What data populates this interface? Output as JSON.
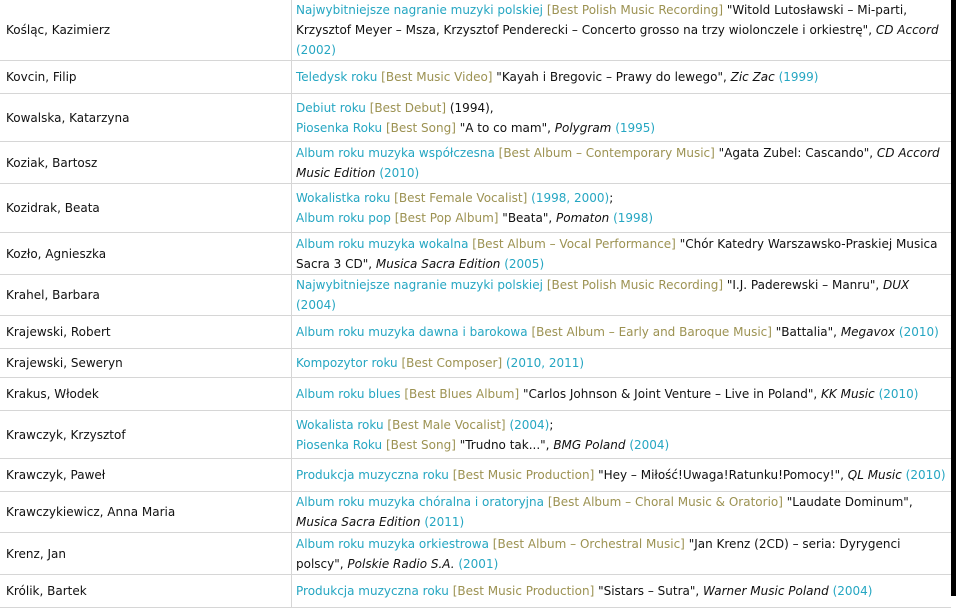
{
  "rows": [
    {
      "name": "Kośląc, Kazimierz",
      "h": 57,
      "lines": [
        [
          {
            "t": "pl",
            "v": "Najwybitniejsze nagranie muzyki polskiej"
          },
          {
            "t": "sp",
            "v": " "
          },
          {
            "t": "en",
            "v": "[Best Polish Music Recording]"
          },
          {
            "t": "tx",
            "v": " \"Witold Lutosławski – Mi-parti, Krzysztof Meyer – Msza, Krzysztof Penderecki – Concerto grosso na trzy wiolonczele i orkiestrę\", "
          },
          {
            "t": "lb",
            "v": "CD Accord"
          },
          {
            "t": "sp",
            "v": " "
          },
          {
            "t": "yr",
            "v": "(2002)"
          }
        ]
      ]
    },
    {
      "name": "Kovcin, Filip",
      "h": 33,
      "lines": [
        [
          {
            "t": "pl",
            "v": "Teledysk roku"
          },
          {
            "t": "sp",
            "v": " "
          },
          {
            "t": "en",
            "v": "[Best Music Video]"
          },
          {
            "t": "tx",
            "v": " \"Kayah i Bregovic – Prawy do lewego\", "
          },
          {
            "t": "lb",
            "v": "Zic Zac"
          },
          {
            "t": "sp",
            "v": " "
          },
          {
            "t": "yr",
            "v": "(1999)"
          }
        ]
      ]
    },
    {
      "name": "Kowalska, Katarzyna",
      "h": 48,
      "lines": [
        [
          {
            "t": "pl",
            "v": "Debiut roku"
          },
          {
            "t": "sp",
            "v": " "
          },
          {
            "t": "en",
            "v": "[Best Debut]"
          },
          {
            "t": "tx",
            "v": " (1994),"
          }
        ],
        [
          {
            "t": "pl",
            "v": "Piosenka Roku"
          },
          {
            "t": "sp",
            "v": " "
          },
          {
            "t": "en",
            "v": "[Best Song]"
          },
          {
            "t": "tx",
            "v": " \"A to co mam\", "
          },
          {
            "t": "lb",
            "v": "Polygram"
          },
          {
            "t": "sp",
            "v": " "
          },
          {
            "t": "yr",
            "v": "(1995)"
          }
        ]
      ]
    },
    {
      "name": "Koziak, Bartosz",
      "h": 42,
      "lines": [
        [
          {
            "t": "pl",
            "v": "Album roku muzyka współczesna"
          },
          {
            "t": "sp",
            "v": " "
          },
          {
            "t": "en",
            "v": "[Best Album – Contemporary Music]"
          },
          {
            "t": "tx",
            "v": " \"Agata Zubel: Cascando\", "
          },
          {
            "t": "lb",
            "v": "CD Accord Music Edition"
          },
          {
            "t": "sp",
            "v": " "
          },
          {
            "t": "yr",
            "v": "(2010)"
          }
        ]
      ]
    },
    {
      "name": "Kozidrak, Beata",
      "h": 49,
      "lines": [
        [
          {
            "t": "pl",
            "v": "Wokalistka roku"
          },
          {
            "t": "sp",
            "v": " "
          },
          {
            "t": "en",
            "v": "[Best Female Vocalist]"
          },
          {
            "t": "sp",
            "v": " "
          },
          {
            "t": "yr",
            "v": "(1998, 2000)"
          },
          {
            "t": "tx",
            "v": ";"
          }
        ],
        [
          {
            "t": "pl",
            "v": "Album roku pop"
          },
          {
            "t": "sp",
            "v": " "
          },
          {
            "t": "en",
            "v": "[Best Pop Album]"
          },
          {
            "t": "tx",
            "v": " \"Beata\", "
          },
          {
            "t": "lb",
            "v": "Pomaton"
          },
          {
            "t": "sp",
            "v": " "
          },
          {
            "t": "yr",
            "v": "(1998)"
          }
        ]
      ]
    },
    {
      "name": "Kozło, Agnieszka",
      "h": 42,
      "lines": [
        [
          {
            "t": "pl",
            "v": "Album roku muzyka wokalna"
          },
          {
            "t": "sp",
            "v": " "
          },
          {
            "t": "en",
            "v": "[Best Album – Vocal Performance]"
          },
          {
            "t": "tx",
            "v": " \"Chór Katedry Warszawsko-Praskiej Musica Sacra 3 CD\", "
          },
          {
            "t": "lb",
            "v": "Musica Sacra Edition"
          },
          {
            "t": "sp",
            "v": " "
          },
          {
            "t": "yr",
            "v": "(2005)"
          }
        ]
      ]
    },
    {
      "name": "Krahel, Barbara",
      "h": 33,
      "lines": [
        [
          {
            "t": "pl",
            "v": "Najwybitniejsze nagranie muzyki polskiej"
          },
          {
            "t": "sp",
            "v": " "
          },
          {
            "t": "en",
            "v": "[Best Polish Music Recording]"
          },
          {
            "t": "tx",
            "v": " \"I.J. Paderewski – Manru\", "
          },
          {
            "t": "lb",
            "v": "DUX"
          },
          {
            "t": "sp",
            "v": " "
          },
          {
            "t": "yr",
            "v": "(2004)"
          }
        ]
      ]
    },
    {
      "name": "Krajewski, Robert",
      "h": 33,
      "lines": [
        [
          {
            "t": "pl",
            "v": "Album roku muzyka dawna i barokowa"
          },
          {
            "t": "sp",
            "v": " "
          },
          {
            "t": "en",
            "v": "[Best Album – Early and Baroque Music]"
          },
          {
            "t": "tx",
            "v": " \"Battalia\", "
          },
          {
            "t": "lb",
            "v": "Megavox"
          },
          {
            "t": "sp",
            "v": " "
          },
          {
            "t": "yr",
            "v": "(2010)"
          }
        ]
      ]
    },
    {
      "name": "Krajewski, Seweryn",
      "h": 29,
      "lines": [
        [
          {
            "t": "pl",
            "v": "Kompozytor roku"
          },
          {
            "t": "sp",
            "v": " "
          },
          {
            "t": "en",
            "v": "[Best Composer]"
          },
          {
            "t": "sp",
            "v": " "
          },
          {
            "t": "yr",
            "v": "(2010, 2011)"
          }
        ]
      ]
    },
    {
      "name": "Krakus, Włodek",
      "h": 33,
      "lines": [
        [
          {
            "t": "pl",
            "v": "Album roku blues"
          },
          {
            "t": "sp",
            "v": " "
          },
          {
            "t": "en",
            "v": "[Best Blues Album]"
          },
          {
            "t": "tx",
            "v": " \"Carlos Johnson & Joint Venture – Live in Poland\", "
          },
          {
            "t": "lb",
            "v": "KK Music"
          },
          {
            "t": "sp",
            "v": " "
          },
          {
            "t": "yr",
            "v": "(2010)"
          }
        ]
      ]
    },
    {
      "name": "Krawczyk, Krzysztof",
      "h": 48,
      "lines": [
        [
          {
            "t": "pl",
            "v": "Wokalista roku"
          },
          {
            "t": "sp",
            "v": " "
          },
          {
            "t": "en",
            "v": "[Best Male Vocalist]"
          },
          {
            "t": "sp",
            "v": " "
          },
          {
            "t": "yr",
            "v": "(2004)"
          },
          {
            "t": "tx",
            "v": ";"
          }
        ],
        [
          {
            "t": "pl",
            "v": "Piosenka Roku"
          },
          {
            "t": "sp",
            "v": " "
          },
          {
            "t": "en",
            "v": "[Best Song]"
          },
          {
            "t": "tx",
            "v": " \"Trudno tak...\", "
          },
          {
            "t": "lb",
            "v": "BMG Poland"
          },
          {
            "t": "sp",
            "v": " "
          },
          {
            "t": "yr",
            "v": "(2004)"
          }
        ]
      ]
    },
    {
      "name": "Krawczyk, Paweł",
      "h": 33,
      "lines": [
        [
          {
            "t": "pl",
            "v": "Produkcja muzyczna roku"
          },
          {
            "t": "sp",
            "v": " "
          },
          {
            "t": "en",
            "v": "[Best Music Production]"
          },
          {
            "t": "tx",
            "v": " \"Hey – Miłość!Uwaga!Ratunku!Pomocy!\", "
          },
          {
            "t": "lb",
            "v": "QL Music"
          },
          {
            "t": "sp",
            "v": " "
          },
          {
            "t": "yr",
            "v": "(2010)"
          }
        ]
      ]
    },
    {
      "name": "Krawczykiewicz, Anna Maria",
      "h": 41,
      "lines": [
        [
          {
            "t": "pl",
            "v": "Album roku muzyka chóralna i oratoryjna"
          },
          {
            "t": "sp",
            "v": " "
          },
          {
            "t": "en",
            "v": "[Best Album – Choral Music & Oratorio]"
          },
          {
            "t": "tx",
            "v": " \"Laudate Dominum\", "
          },
          {
            "t": "lb",
            "v": "Musica Sacra Edition"
          },
          {
            "t": "sp",
            "v": " "
          },
          {
            "t": "yr",
            "v": "(2011)"
          }
        ]
      ]
    },
    {
      "name": "Krenz, Jan",
      "h": 42,
      "lines": [
        [
          {
            "t": "pl",
            "v": "Album roku muzyka orkiestrowa"
          },
          {
            "t": "sp",
            "v": " "
          },
          {
            "t": "en",
            "v": "[Best Album – Orchestral Music]"
          },
          {
            "t": "tx",
            "v": " \"Jan Krenz (2CD) – seria: Dyrygenci polscy\", "
          },
          {
            "t": "lb",
            "v": "Polskie Radio S.A."
          },
          {
            "t": "sp",
            "v": " "
          },
          {
            "t": "yr",
            "v": "(2001)"
          }
        ]
      ]
    },
    {
      "name": "Królik, Bartek",
      "h": 33,
      "lines": [
        [
          {
            "t": "pl",
            "v": "Produkcja muzyczna roku"
          },
          {
            "t": "sp",
            "v": " "
          },
          {
            "t": "en",
            "v": "[Best Music Production]"
          },
          {
            "t": "tx",
            "v": " \"Sistars – Sutra\", "
          },
          {
            "t": "lb",
            "v": "Warner Music Poland"
          },
          {
            "t": "sp",
            "v": " "
          },
          {
            "t": "yr",
            "v": "(2004)"
          }
        ]
      ]
    }
  ]
}
